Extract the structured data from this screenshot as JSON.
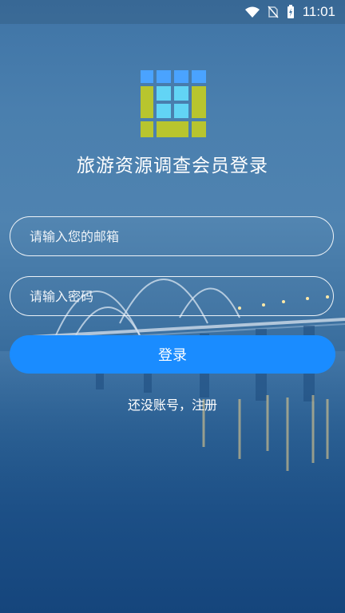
{
  "status_bar": {
    "time": "11:01",
    "icons": [
      "wifi-icon",
      "no-sim-icon",
      "battery-charging-icon"
    ]
  },
  "app": {
    "title": "旅游资源调查会员登录",
    "logo": "grid-logo"
  },
  "form": {
    "email_placeholder": "请输入您的邮箱",
    "password_placeholder": "请输入密码",
    "login_label": "登录",
    "register_text": "还没账号，注册"
  },
  "colors": {
    "accent": "#1a8cff",
    "background_top": "#4a7fae",
    "background_bottom": "#15457c"
  }
}
